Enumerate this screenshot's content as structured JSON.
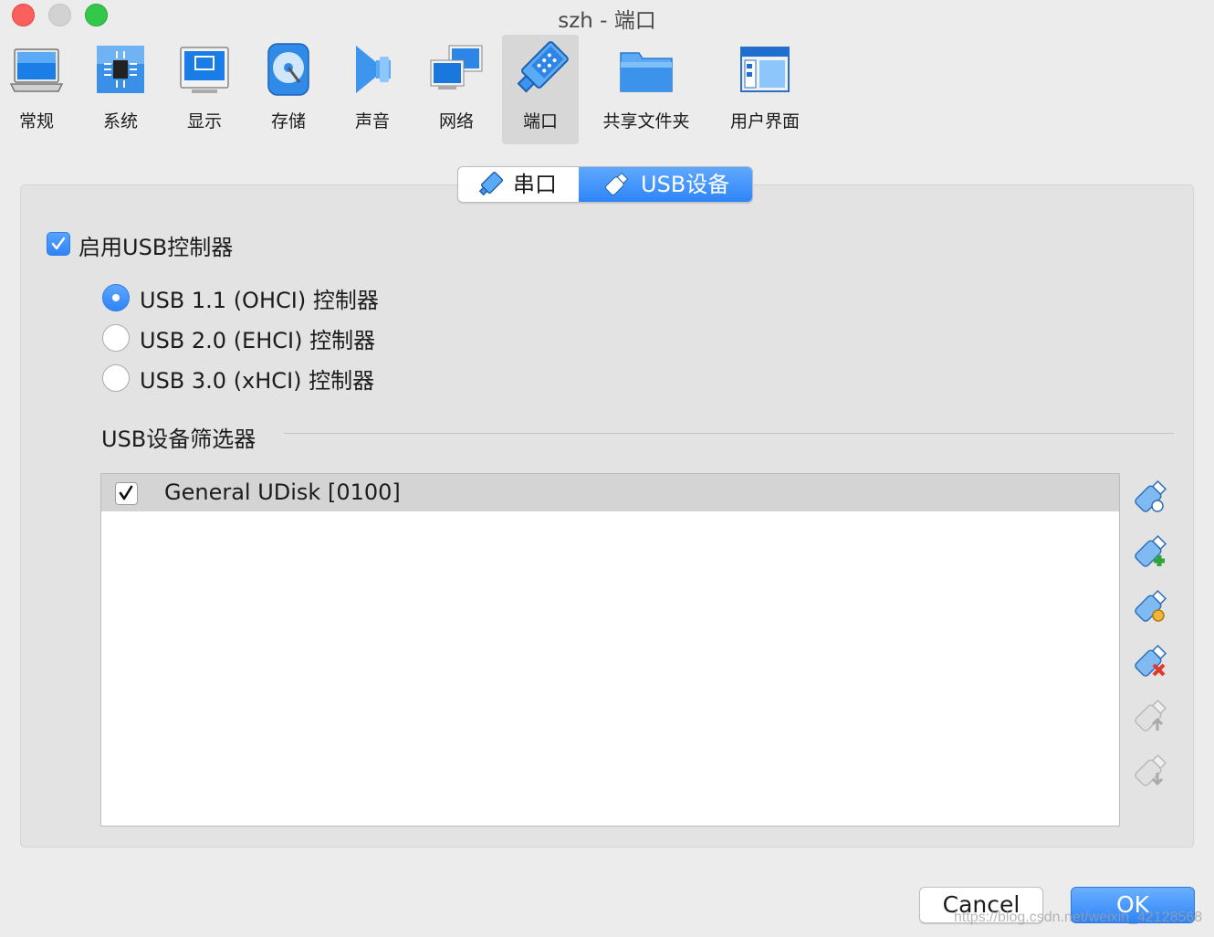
{
  "window": {
    "title": "szh - 端口"
  },
  "toolbar": {
    "items": [
      {
        "label": "常规",
        "icon": "general-icon"
      },
      {
        "label": "系统",
        "icon": "system-icon"
      },
      {
        "label": "显示",
        "icon": "display-icon"
      },
      {
        "label": "存储",
        "icon": "storage-icon"
      },
      {
        "label": "声音",
        "icon": "audio-icon"
      },
      {
        "label": "网络",
        "icon": "network-icon"
      },
      {
        "label": "端口",
        "icon": "ports-icon",
        "active": true
      },
      {
        "label": "共享文件夹",
        "icon": "shared-folders-icon"
      },
      {
        "label": "用户界面",
        "icon": "user-interface-icon"
      }
    ]
  },
  "tabs": {
    "serial": "串口",
    "usb": "USB设备",
    "selected": "usb"
  },
  "usb": {
    "enable_label": "启用USB控制器",
    "enable_checked": true,
    "controllers": [
      {
        "label": "USB 1.1 (OHCI) 控制器",
        "selected": true
      },
      {
        "label": "USB 2.0 (EHCI) 控制器",
        "selected": false
      },
      {
        "label": "USB 3.0 (xHCI) 控制器",
        "selected": false
      }
    ],
    "filters_label": "USB设备筛选器",
    "filters": [
      {
        "name": "General UDisk [0100]",
        "checked": true
      }
    ]
  },
  "side_tools": [
    "usb-filter-add-empty-icon",
    "usb-filter-add-device-icon",
    "usb-filter-edit-icon",
    "usb-filter-remove-icon",
    "usb-filter-move-up-icon",
    "usb-filter-move-down-icon"
  ],
  "buttons": {
    "cancel": "Cancel",
    "ok": "OK"
  },
  "watermark": "https://blog.csdn.net/weixin_42128568",
  "colors": {
    "accent": "#2f85f8",
    "background": "#ececec"
  }
}
